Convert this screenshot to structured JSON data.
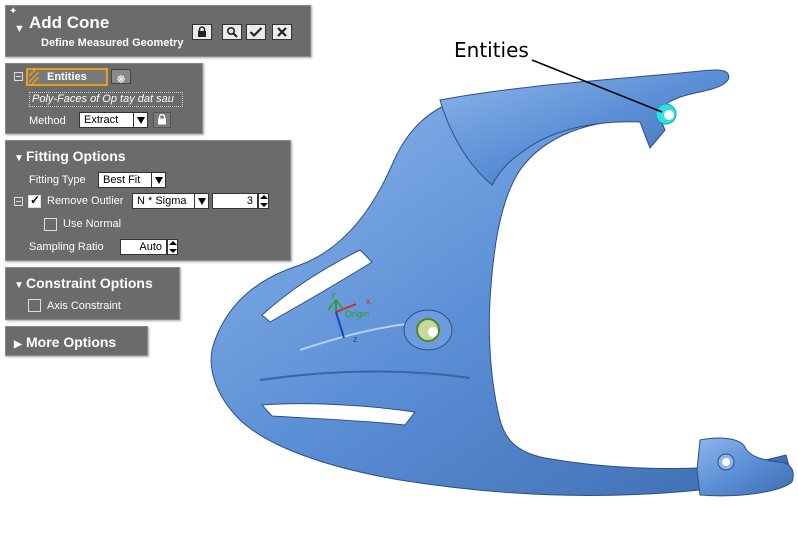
{
  "header": {
    "title": "Add Cone",
    "subtitle": "Define Measured Geometry"
  },
  "entities_panel": {
    "entities_label": "Entities",
    "selection_value": "Poly-Faces of Op tay dat sau",
    "method_label": "Method",
    "method_value": "Extract"
  },
  "fitting_options": {
    "title": "Fitting Options",
    "fitting_type_label": "Fitting Type",
    "fitting_type_value": "Best Fit",
    "remove_outlier_label": "Remove Outlier",
    "remove_outlier_checked": true,
    "outlier_mode_value": "N * Sigma",
    "outlier_n_value": "3",
    "use_normal_label": "Use Normal",
    "use_normal_checked": false,
    "sampling_ratio_label": "Sampling Ratio",
    "sampling_ratio_value": "Auto"
  },
  "constraint_options": {
    "title": "Constraint Options",
    "axis_constraint_label": "Axis Constraint",
    "axis_constraint_checked": false
  },
  "more_options": {
    "title": "More Options"
  },
  "viewport": {
    "callout_label": "Entities",
    "axis_y": "y",
    "axis_x": "x",
    "axis_z": "z",
    "origin_label": "Origin",
    "colors": {
      "part": "#5b8fd6",
      "panel": "#6b6b6b",
      "highlight": "#2fe0e8",
      "active_border": "#e5a11c"
    }
  }
}
